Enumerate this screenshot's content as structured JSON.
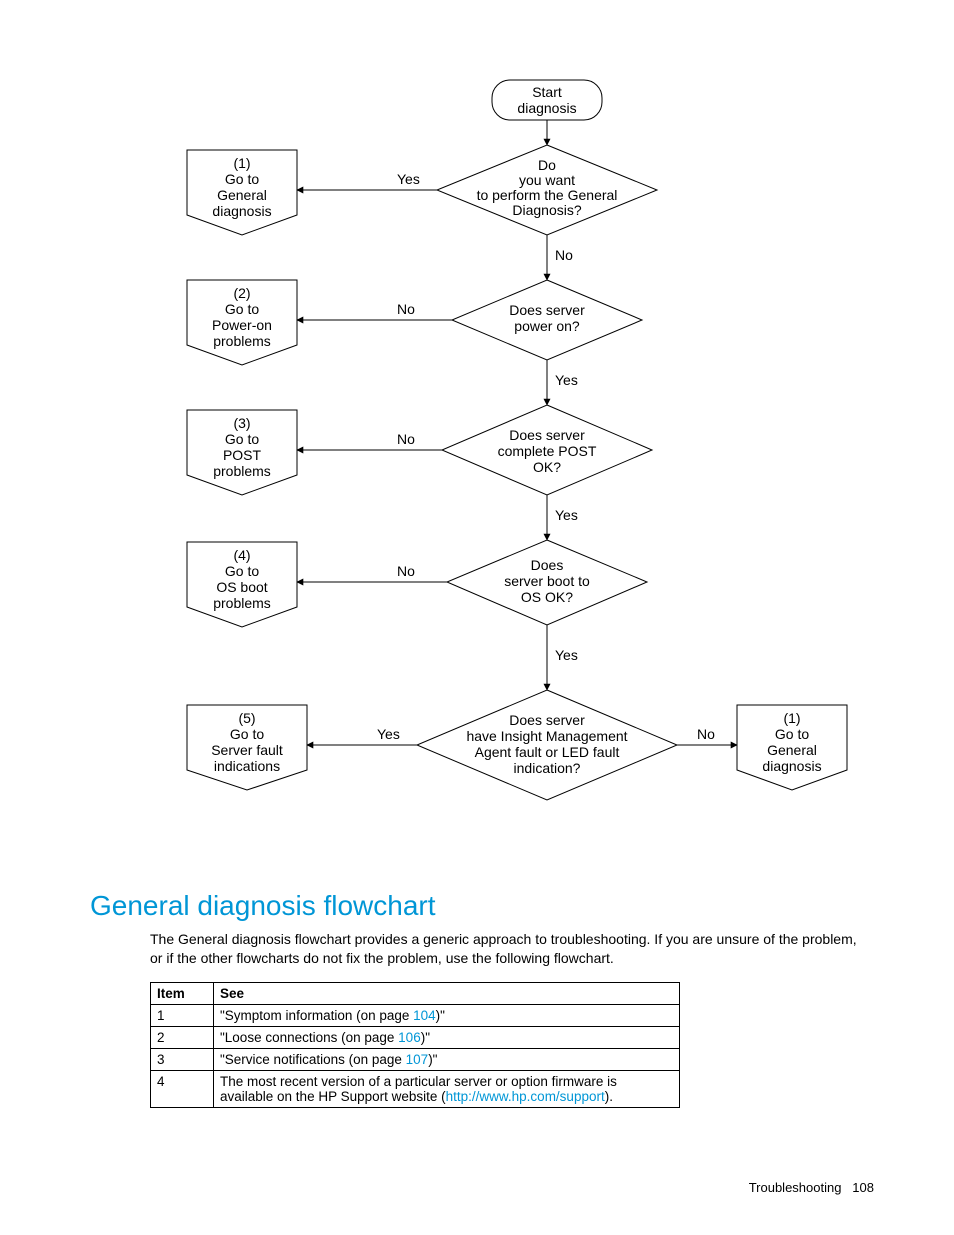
{
  "flowchart": {
    "start": "Start\ndiagnosis",
    "decisions": [
      {
        "text": "Do\nyou want\nto perform the General\nDiagnosis?",
        "yes": "Yes",
        "no": "No",
        "yesDir": "left",
        "noDir": "down"
      },
      {
        "text": "Does server\npower on?",
        "yes": "Yes",
        "no": "No",
        "yesDir": "down",
        "noDir": "left"
      },
      {
        "text": "Does server\ncomplete POST\nOK?",
        "yes": "Yes",
        "no": "No",
        "yesDir": "down",
        "noDir": "left"
      },
      {
        "text": "Does\nserver boot to\nOS OK?",
        "yes": "Yes",
        "no": "No",
        "yesDir": "down",
        "noDir": "left"
      },
      {
        "text": "Does server\nhave Insight Management\nAgent fault or LED fault\nindication?",
        "yes": "Yes",
        "no": "No",
        "yesDir": "left",
        "noDir": "right"
      }
    ],
    "offpageLeft": [
      {
        "num": "(1)",
        "l1": "Go to",
        "l2": "General",
        "l3": "diagnosis"
      },
      {
        "num": "(2)",
        "l1": "Go to",
        "l2": "Power-on",
        "l3": "problems"
      },
      {
        "num": "(3)",
        "l1": "Go to",
        "l2": "POST",
        "l3": "problems"
      },
      {
        "num": "(4)",
        "l1": "Go to",
        "l2": "OS boot",
        "l3": "problems"
      },
      {
        "num": "(5)",
        "l1": "Go to",
        "l2": "Server fault",
        "l3": "indications"
      }
    ],
    "offpageRight": {
      "num": "(1)",
      "l1": "Go to",
      "l2": "General",
      "l3": "diagnosis"
    }
  },
  "section": {
    "title": "General diagnosis flowchart",
    "body": "The General diagnosis flowchart provides a generic approach to troubleshooting. If you are unsure of the problem, or if the other flowcharts do not fix the problem, use the following flowchart."
  },
  "table": {
    "headers": [
      "Item",
      "See"
    ],
    "rows": [
      {
        "item": "1",
        "pre": "\"Symptom information (on page ",
        "link": "104",
        "post": ")\""
      },
      {
        "item": "2",
        "pre": "\"Loose connections (on page ",
        "link": "106",
        "post": ")\""
      },
      {
        "item": "3",
        "pre": "\"Service notifications (on page ",
        "link": "107",
        "post": ")\""
      },
      {
        "item": "4",
        "pre": "The most recent version of a particular server or option firmware is available on the HP Support website (",
        "link": "http://www.hp.com/support",
        "post": ")."
      }
    ]
  },
  "footer": {
    "section": "Troubleshooting",
    "page": "108"
  }
}
